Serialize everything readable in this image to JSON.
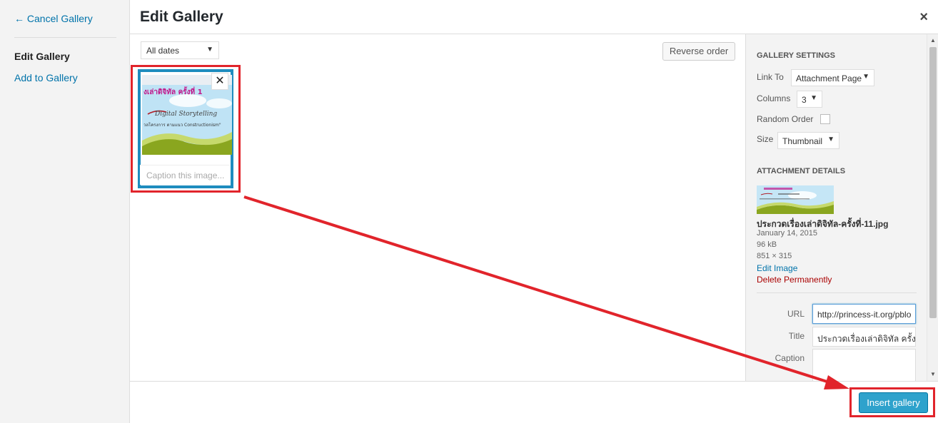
{
  "menu": {
    "cancel_label": "← Cancel Gallery",
    "active_item": "Edit Gallery",
    "add_item": "Add to Gallery"
  },
  "header": {
    "title": "Edit Gallery",
    "close_glyph": "×"
  },
  "toolbar": {
    "date_filter": "All dates",
    "reverse_label": "Reverse order"
  },
  "attachment": {
    "thumb_title_text": "งเล่าดิจิทัล ครั้งที่ 1",
    "thumb_script_text": "Digital Storytelling",
    "thumb_sub_text": "วลโครงการ ตามแนว Constructionism\"",
    "caption_placeholder": "Caption this image...",
    "remove_glyph": "✕"
  },
  "sidebar": {
    "gallery_settings_heading": "GALLERY SETTINGS",
    "link_to_label": "Link To",
    "link_to_value": "Attachment Page",
    "columns_label": "Columns",
    "columns_value": "3",
    "random_order_label": "Random Order",
    "random_order_checked": false,
    "size_label": "Size",
    "size_value": "Thumbnail",
    "attachment_details_heading": "ATTACHMENT DETAILS",
    "filename": "ประกวดเรื่องเล่าดิจิทัล-ครั้งที่-11.jpg",
    "date": "January 14, 2015",
    "filesize": "96 kB",
    "dimensions": "851 × 315",
    "edit_image_label": "Edit Image",
    "delete_label": "Delete Permanently",
    "url_label": "URL",
    "url_value": "http://princess-it.org/pblo",
    "title_label": "Title",
    "title_value": "ประกวดเรื่องเล่าดิจิทัล ครั้งที่",
    "caption_label": "Caption",
    "caption_value": ""
  },
  "footer": {
    "insert_label": "Insert gallery"
  },
  "colors": {
    "accent": "#2ea2cc",
    "link": "#0073aa",
    "delete": "#aa0000",
    "annotation": "#e1242b",
    "selection": "#1e8cbe"
  }
}
